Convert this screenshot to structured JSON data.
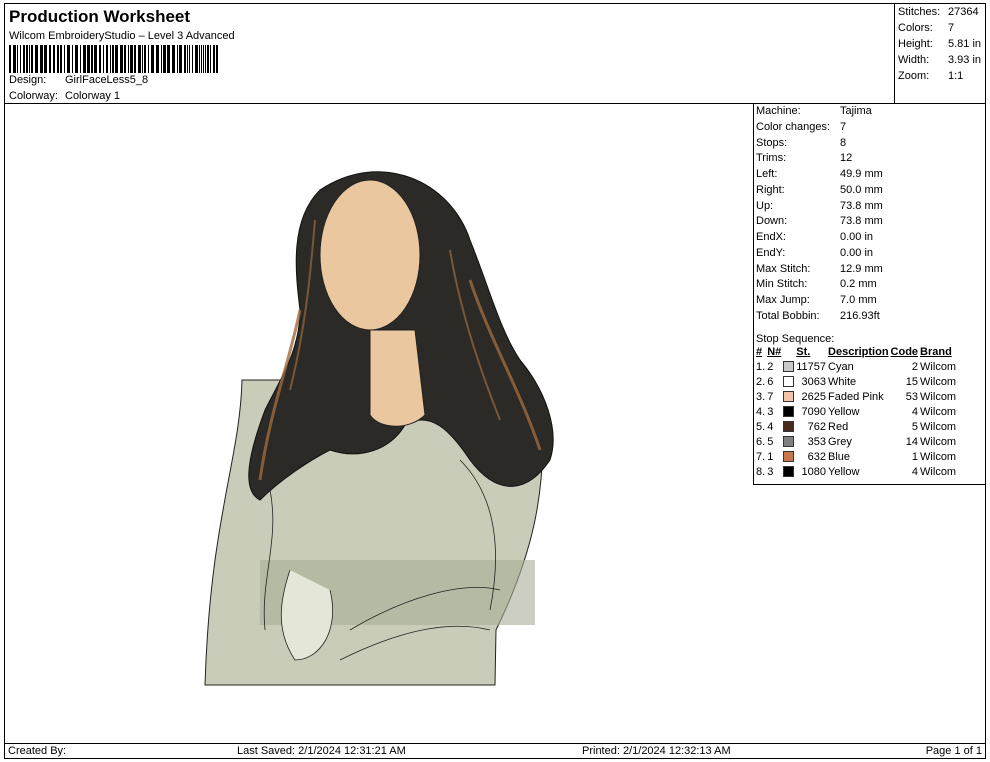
{
  "header": {
    "title": "Production Worksheet",
    "subtitle": "Wilcom EmbroideryStudio – Level 3 Advanced",
    "design_label": "Design:",
    "design_value": "GirlFaceLess5_8",
    "colorway_label": "Colorway:",
    "colorway_value": "Colorway 1"
  },
  "summary": {
    "stitches_label": "Stitches:",
    "stitches": "27364",
    "colors_label": "Colors:",
    "colors": "7",
    "height_label": "Height:",
    "height": "5.81 in",
    "width_label": "Width:",
    "width": "3.93 in",
    "zoom_label": "Zoom:",
    "zoom": "1:1"
  },
  "info": [
    {
      "label": "Machine:",
      "value": "Tajima"
    },
    {
      "label": "Color changes:",
      "value": "7"
    },
    {
      "label": "Stops:",
      "value": "8"
    },
    {
      "label": "Trims:",
      "value": "12"
    },
    {
      "label": "Left:",
      "value": "49.9 mm"
    },
    {
      "label": "Right:",
      "value": "50.0 mm"
    },
    {
      "label": "Up:",
      "value": "73.8 mm"
    },
    {
      "label": "Down:",
      "value": "73.8 mm"
    },
    {
      "label": "EndX:",
      "value": "0.00 in"
    },
    {
      "label": "EndY:",
      "value": "0.00 in"
    },
    {
      "label": "Max Stitch:",
      "value": "12.9 mm"
    },
    {
      "label": "Min Stitch:",
      "value": "0.2 mm"
    },
    {
      "label": "Max Jump:",
      "value": "7.0 mm"
    },
    {
      "label": "Total Bobbin:",
      "value": "216.93ft"
    }
  ],
  "stop_sequence": {
    "title": "Stop Sequence:",
    "headers": {
      "idx": "#",
      "n": "N#",
      "st": "St.",
      "desc": "Description",
      "code": "Code",
      "brand": "Brand"
    },
    "rows": [
      {
        "idx": "1.",
        "n": "2",
        "color": "#c9c9c9",
        "st": "11757",
        "desc": "Cyan",
        "code": "2",
        "brand": "Wilcom"
      },
      {
        "idx": "2.",
        "n": "6",
        "color": "#ffffff",
        "st": "3063",
        "desc": "White",
        "code": "15",
        "brand": "Wilcom"
      },
      {
        "idx": "3.",
        "n": "7",
        "color": "#f3c3a9",
        "st": "2625",
        "desc": "Faded Pink",
        "code": "53",
        "brand": "Wilcom"
      },
      {
        "idx": "4.",
        "n": "3",
        "color": "#000000",
        "st": "7090",
        "desc": "Yellow",
        "code": "4",
        "brand": "Wilcom"
      },
      {
        "idx": "5.",
        "n": "4",
        "color": "#4a2a1f",
        "st": "762",
        "desc": "Red",
        "code": "5",
        "brand": "Wilcom"
      },
      {
        "idx": "6.",
        "n": "5",
        "color": "#808080",
        "st": "353",
        "desc": "Grey",
        "code": "14",
        "brand": "Wilcom"
      },
      {
        "idx": "7.",
        "n": "1",
        "color": "#c8764a",
        "st": "632",
        "desc": "Blue",
        "code": "1",
        "brand": "Wilcom"
      },
      {
        "idx": "8.",
        "n": "3",
        "color": "#000000",
        "st": "1080",
        "desc": "Yellow",
        "code": "4",
        "brand": "Wilcom"
      }
    ]
  },
  "footer": {
    "created_by": "Created By:",
    "last_saved": "Last Saved: 2/1/2024 12:31:21 AM",
    "printed": "Printed: 2/1/2024 12:32:13 AM",
    "page": "Page 1 of 1"
  },
  "design_preview": {
    "icon": "embroidery-design-preview",
    "colors": {
      "sweater": "#c9ccb8",
      "sweater_dark": "#a8ad98",
      "hair": "#2b2a27",
      "hair_highlight": "#9c6a3e",
      "skin": "#eac79f"
    }
  }
}
